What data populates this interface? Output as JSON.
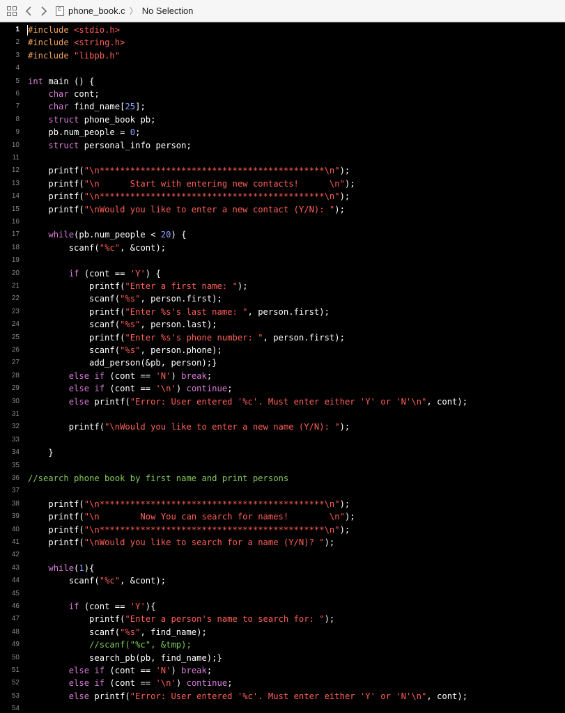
{
  "toolbar": {
    "icons": [
      "grid-icon",
      "chevron-left-icon",
      "chevron-right-icon",
      "c-file-icon"
    ],
    "breadcrumb": {
      "file": "phone_book.c",
      "separator": "〉",
      "selection": "No Selection"
    }
  },
  "editor": {
    "active_line": 1,
    "colors": {
      "keyword": "#d97bd8",
      "string": "#ff5f57",
      "preprocessor": "#f0a35a",
      "number": "#8aa3ff",
      "comment": "#80cc59",
      "plain": "#ffffff"
    },
    "lines": [
      {
        "num": "1",
        "tokens": [
          {
            "t": "p",
            "v": "#include "
          },
          {
            "t": "s",
            "v": "<stdio.h>"
          }
        ]
      },
      {
        "num": "2",
        "tokens": [
          {
            "t": "p",
            "v": "#include "
          },
          {
            "t": "s",
            "v": "<string.h>"
          }
        ]
      },
      {
        "num": "3",
        "tokens": [
          {
            "t": "p",
            "v": "#include "
          },
          {
            "t": "s",
            "v": "\"libpb.h\""
          }
        ]
      },
      {
        "num": "4",
        "tokens": []
      },
      {
        "num": "5",
        "tokens": [
          {
            "t": "k",
            "v": "int"
          },
          {
            "t": "x",
            "v": " main () {"
          }
        ]
      },
      {
        "num": "6",
        "tokens": [
          {
            "t": "x",
            "v": "    "
          },
          {
            "t": "k",
            "v": "char"
          },
          {
            "t": "x",
            "v": " cont;"
          }
        ]
      },
      {
        "num": "7",
        "tokens": [
          {
            "t": "x",
            "v": "    "
          },
          {
            "t": "k",
            "v": "char"
          },
          {
            "t": "x",
            "v": " find_name["
          },
          {
            "t": "n",
            "v": "25"
          },
          {
            "t": "x",
            "v": "];"
          }
        ]
      },
      {
        "num": "8",
        "tokens": [
          {
            "t": "x",
            "v": "    "
          },
          {
            "t": "k",
            "v": "struct"
          },
          {
            "t": "x",
            "v": " phone_book pb;"
          }
        ]
      },
      {
        "num": "9",
        "tokens": [
          {
            "t": "x",
            "v": "    pb.num_people = "
          },
          {
            "t": "n",
            "v": "0"
          },
          {
            "t": "x",
            "v": ";"
          }
        ]
      },
      {
        "num": "10",
        "tokens": [
          {
            "t": "x",
            "v": "    "
          },
          {
            "t": "k",
            "v": "struct"
          },
          {
            "t": "x",
            "v": " personal_info person;"
          }
        ]
      },
      {
        "num": "11",
        "tokens": []
      },
      {
        "num": "12",
        "tokens": [
          {
            "t": "x",
            "v": "    printf("
          },
          {
            "t": "s",
            "v": "\"\\n********************************************\\n\""
          },
          {
            "t": "x",
            "v": ");"
          }
        ]
      },
      {
        "num": "13",
        "tokens": [
          {
            "t": "x",
            "v": "    printf("
          },
          {
            "t": "s",
            "v": "\"\\n      Start with entering new contacts!      \\n\""
          },
          {
            "t": "x",
            "v": ");"
          }
        ]
      },
      {
        "num": "14",
        "tokens": [
          {
            "t": "x",
            "v": "    printf("
          },
          {
            "t": "s",
            "v": "\"\\n********************************************\\n\""
          },
          {
            "t": "x",
            "v": ");"
          }
        ]
      },
      {
        "num": "15",
        "tokens": [
          {
            "t": "x",
            "v": "    printf("
          },
          {
            "t": "s",
            "v": "\"\\nWould you like to enter a new contact (Y/N): \""
          },
          {
            "t": "x",
            "v": ");"
          }
        ]
      },
      {
        "num": "16",
        "tokens": []
      },
      {
        "num": "17",
        "tokens": [
          {
            "t": "x",
            "v": "    "
          },
          {
            "t": "k",
            "v": "while"
          },
          {
            "t": "x",
            "v": "(pb.num_people < "
          },
          {
            "t": "n",
            "v": "20"
          },
          {
            "t": "x",
            "v": ") {"
          }
        ]
      },
      {
        "num": "18",
        "tokens": [
          {
            "t": "x",
            "v": "        scanf("
          },
          {
            "t": "s",
            "v": "\"%c\""
          },
          {
            "t": "x",
            "v": ", &cont);"
          }
        ]
      },
      {
        "num": "19",
        "tokens": []
      },
      {
        "num": "20",
        "tokens": [
          {
            "t": "x",
            "v": "        "
          },
          {
            "t": "k",
            "v": "if"
          },
          {
            "t": "x",
            "v": " (cont == "
          },
          {
            "t": "s",
            "v": "'Y'"
          },
          {
            "t": "x",
            "v": ") {"
          }
        ]
      },
      {
        "num": "21",
        "tokens": [
          {
            "t": "x",
            "v": "            printf("
          },
          {
            "t": "s",
            "v": "\"Enter a first name: \""
          },
          {
            "t": "x",
            "v": ");"
          }
        ]
      },
      {
        "num": "22",
        "tokens": [
          {
            "t": "x",
            "v": "            scanf("
          },
          {
            "t": "s",
            "v": "\"%s\""
          },
          {
            "t": "x",
            "v": ", person.first);"
          }
        ]
      },
      {
        "num": "23",
        "tokens": [
          {
            "t": "x",
            "v": "            printf("
          },
          {
            "t": "s",
            "v": "\"Enter %s's last name: \""
          },
          {
            "t": "x",
            "v": ", person.first);"
          }
        ]
      },
      {
        "num": "24",
        "tokens": [
          {
            "t": "x",
            "v": "            scanf("
          },
          {
            "t": "s",
            "v": "\"%s\""
          },
          {
            "t": "x",
            "v": ", person.last);"
          }
        ]
      },
      {
        "num": "25",
        "tokens": [
          {
            "t": "x",
            "v": "            printf("
          },
          {
            "t": "s",
            "v": "\"Enter %s's phone number: \""
          },
          {
            "t": "x",
            "v": ", person.first);"
          }
        ]
      },
      {
        "num": "26",
        "tokens": [
          {
            "t": "x",
            "v": "            scanf("
          },
          {
            "t": "s",
            "v": "\"%s\""
          },
          {
            "t": "x",
            "v": ", person.phone);"
          }
        ]
      },
      {
        "num": "27",
        "tokens": [
          {
            "t": "x",
            "v": "            add_person(&pb, person);}"
          }
        ]
      },
      {
        "num": "28",
        "tokens": [
          {
            "t": "x",
            "v": "        "
          },
          {
            "t": "k",
            "v": "else if"
          },
          {
            "t": "x",
            "v": " (cont == "
          },
          {
            "t": "s",
            "v": "'N'"
          },
          {
            "t": "x",
            "v": ") "
          },
          {
            "t": "k",
            "v": "break"
          },
          {
            "t": "x",
            "v": ";"
          }
        ]
      },
      {
        "num": "29",
        "tokens": [
          {
            "t": "x",
            "v": "        "
          },
          {
            "t": "k",
            "v": "else if"
          },
          {
            "t": "x",
            "v": " (cont == "
          },
          {
            "t": "s",
            "v": "'\\n'"
          },
          {
            "t": "x",
            "v": ") "
          },
          {
            "t": "k",
            "v": "continue"
          },
          {
            "t": "x",
            "v": ";"
          }
        ]
      },
      {
        "num": "30",
        "tokens": [
          {
            "t": "x",
            "v": "        "
          },
          {
            "t": "k",
            "v": "else"
          },
          {
            "t": "x",
            "v": " printf("
          },
          {
            "t": "s",
            "v": "\"Error: User entered '%c'. Must enter either 'Y' or 'N'\\n\""
          },
          {
            "t": "x",
            "v": ", cont);"
          }
        ]
      },
      {
        "num": "31",
        "tokens": []
      },
      {
        "num": "32",
        "tokens": [
          {
            "t": "x",
            "v": "        printf("
          },
          {
            "t": "s",
            "v": "\"\\nWould you like to enter a new name (Y/N): \""
          },
          {
            "t": "x",
            "v": ");"
          }
        ]
      },
      {
        "num": "33",
        "tokens": []
      },
      {
        "num": "34",
        "tokens": [
          {
            "t": "x",
            "v": "    }"
          }
        ]
      },
      {
        "num": "35",
        "tokens": []
      },
      {
        "num": "36",
        "tokens": [
          {
            "t": "c",
            "v": "//search phone book by first name and print persons"
          }
        ]
      },
      {
        "num": "37",
        "tokens": []
      },
      {
        "num": "38",
        "tokens": [
          {
            "t": "x",
            "v": "    printf("
          },
          {
            "t": "s",
            "v": "\"\\n********************************************\\n\""
          },
          {
            "t": "x",
            "v": ");"
          }
        ]
      },
      {
        "num": "39",
        "tokens": [
          {
            "t": "x",
            "v": "    printf("
          },
          {
            "t": "s",
            "v": "\"\\n        Now You can search for names!        \\n\""
          },
          {
            "t": "x",
            "v": ");"
          }
        ]
      },
      {
        "num": "40",
        "tokens": [
          {
            "t": "x",
            "v": "    printf("
          },
          {
            "t": "s",
            "v": "\"\\n********************************************\\n\""
          },
          {
            "t": "x",
            "v": ");"
          }
        ]
      },
      {
        "num": "41",
        "tokens": [
          {
            "t": "x",
            "v": "    printf("
          },
          {
            "t": "s",
            "v": "\"\\nWould you like to search for a name (Y/N)? \""
          },
          {
            "t": "x",
            "v": ");"
          }
        ]
      },
      {
        "num": "42",
        "tokens": []
      },
      {
        "num": "43",
        "tokens": [
          {
            "t": "x",
            "v": "    "
          },
          {
            "t": "k",
            "v": "while"
          },
          {
            "t": "x",
            "v": "("
          },
          {
            "t": "n",
            "v": "1"
          },
          {
            "t": "x",
            "v": "){"
          }
        ]
      },
      {
        "num": "44",
        "tokens": [
          {
            "t": "x",
            "v": "        scanf("
          },
          {
            "t": "s",
            "v": "\"%c\""
          },
          {
            "t": "x",
            "v": ", &cont);"
          }
        ]
      },
      {
        "num": "45",
        "tokens": []
      },
      {
        "num": "46",
        "tokens": [
          {
            "t": "x",
            "v": "        "
          },
          {
            "t": "k",
            "v": "if"
          },
          {
            "t": "x",
            "v": " (cont == "
          },
          {
            "t": "s",
            "v": "'Y'"
          },
          {
            "t": "x",
            "v": "){"
          }
        ]
      },
      {
        "num": "47",
        "tokens": [
          {
            "t": "x",
            "v": "            printf("
          },
          {
            "t": "s",
            "v": "\"Enter a person's name to search for: \""
          },
          {
            "t": "x",
            "v": ");"
          }
        ]
      },
      {
        "num": "48",
        "tokens": [
          {
            "t": "x",
            "v": "            scanf("
          },
          {
            "t": "s",
            "v": "\"%s\""
          },
          {
            "t": "x",
            "v": ", find_name);"
          }
        ]
      },
      {
        "num": "49",
        "tokens": [
          {
            "t": "x",
            "v": "            "
          },
          {
            "t": "c",
            "v": "//scanf(\"%c\", &tmp);"
          }
        ]
      },
      {
        "num": "50",
        "tokens": [
          {
            "t": "x",
            "v": "            search_pb(pb, find_name);}"
          }
        ]
      },
      {
        "num": "51",
        "tokens": [
          {
            "t": "x",
            "v": "        "
          },
          {
            "t": "k",
            "v": "else if"
          },
          {
            "t": "x",
            "v": " (cont == "
          },
          {
            "t": "s",
            "v": "'N'"
          },
          {
            "t": "x",
            "v": ") "
          },
          {
            "t": "k",
            "v": "break"
          },
          {
            "t": "x",
            "v": ";"
          }
        ]
      },
      {
        "num": "52",
        "tokens": [
          {
            "t": "x",
            "v": "        "
          },
          {
            "t": "k",
            "v": "else if"
          },
          {
            "t": "x",
            "v": " (cont == "
          },
          {
            "t": "s",
            "v": "'\\n'"
          },
          {
            "t": "x",
            "v": ") "
          },
          {
            "t": "k",
            "v": "continue"
          },
          {
            "t": "x",
            "v": ";"
          }
        ]
      },
      {
        "num": "53",
        "tokens": [
          {
            "t": "x",
            "v": "        "
          },
          {
            "t": "k",
            "v": "else"
          },
          {
            "t": "x",
            "v": " printf("
          },
          {
            "t": "s",
            "v": "\"Error: User entered '%c'. Must enter either 'Y' or 'N'\\n\""
          },
          {
            "t": "x",
            "v": ", cont);"
          }
        ]
      },
      {
        "num": "54",
        "tokens": []
      }
    ]
  }
}
